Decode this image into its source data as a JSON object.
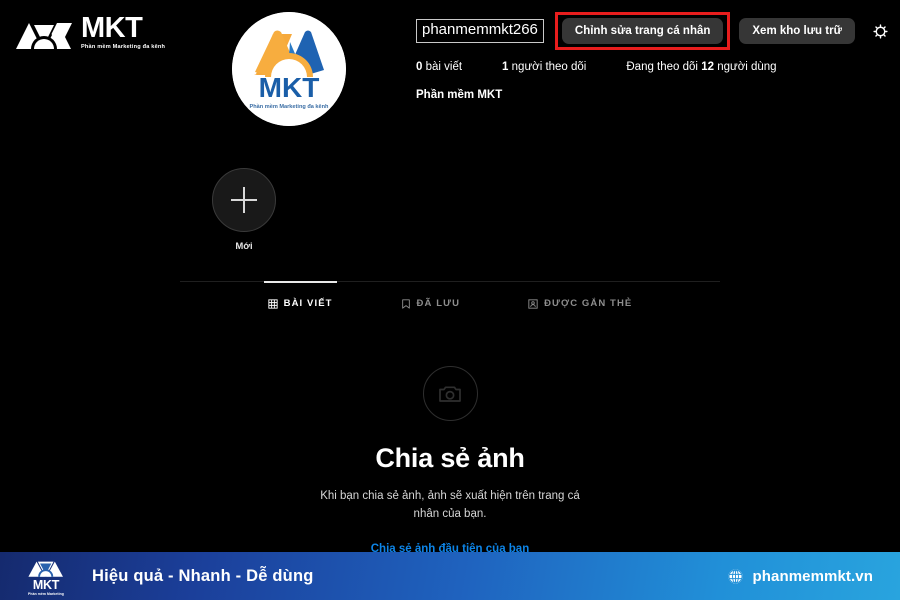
{
  "brand": {
    "name": "MKT",
    "tagline": "Phần mềm Marketing đa kênh"
  },
  "profile": {
    "avatar_alt": "mkt-logo-avatar",
    "username": "phanmemmkt266",
    "edit_profile_label": "Chỉnh sửa trang cá nhân",
    "archive_label": "Xem kho lưu trữ",
    "settings_icon": "gear-icon",
    "stats": [
      {
        "count": "0",
        "label": "bài viết",
        "bold_first": true
      },
      {
        "count": "1",
        "label": "người theo dõi",
        "bold_first": true
      },
      {
        "prefix": "Đang theo dõi",
        "count": "12",
        "label": "người dùng",
        "bold_first": false
      }
    ],
    "full_name": "Phần mềm MKT"
  },
  "highlights": [
    {
      "label": "Mới",
      "icon": "plus-icon"
    }
  ],
  "tabs": [
    {
      "label": "BÀI VIẾT",
      "icon": "grid-icon",
      "active": true
    },
    {
      "label": "ĐÃ LƯU",
      "icon": "bookmark-icon",
      "active": false
    },
    {
      "label": "ĐƯỢC GẮN THẺ",
      "icon": "tagged-icon",
      "active": false
    }
  ],
  "empty_state": {
    "icon": "camera-icon",
    "title": "Chia sẻ ảnh",
    "subtitle": "Khi bạn chia sẻ ảnh, ảnh sẽ xuất hiện trên trang cá nhân của bạn.",
    "link": "Chia sẻ ảnh đầu tiên của bạn"
  },
  "footer": {
    "logo_name": "MKT",
    "logo_tagline": "Phần mềm Marketing",
    "slogan": "Hiệu quả - Nhanh  - Dễ dùng",
    "website": "phanmemmkt.vn",
    "globe_icon": "globe-icon"
  },
  "colors": {
    "background": "#000000",
    "button_gray": "#363636",
    "highlight_red": "#e81d1d",
    "link_blue": "#0d85e8",
    "footer_start": "#152a6e",
    "footer_end": "#29a4de",
    "logo_orange": "#f5a23a",
    "logo_blue": "#1e63b0"
  }
}
